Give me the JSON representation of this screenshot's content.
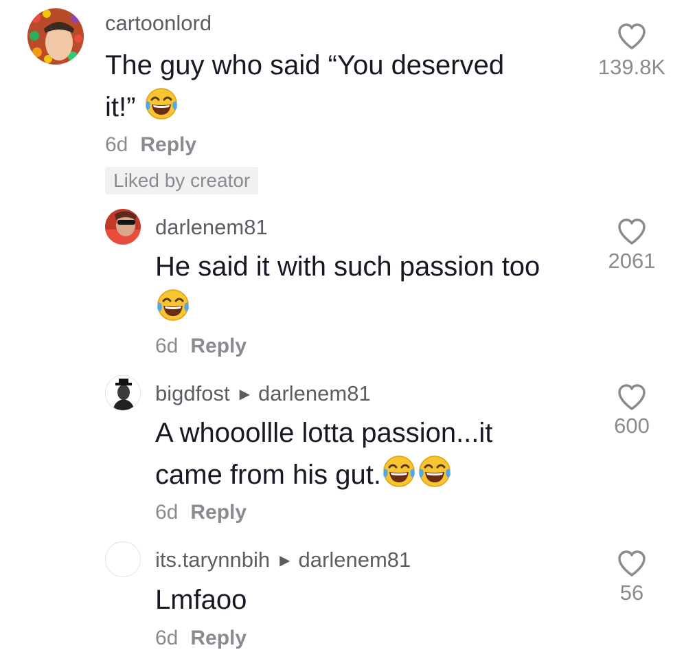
{
  "comments": [
    {
      "username": "cartoonlord",
      "reply_to": "",
      "text": "The guy who said “You deserved",
      "text_line2": "it!”",
      "emoji": [
        "face-with-tears-of-joy"
      ],
      "time": "6d",
      "reply_label": "Reply",
      "likes": "139.8K",
      "badge": "Liked by creator"
    },
    {
      "username": "darlenem81",
      "reply_to": "",
      "text": "He said it with such passion too",
      "emoji": [
        "face-with-tears-of-joy"
      ],
      "time": "6d",
      "reply_label": "Reply",
      "likes": "2061"
    },
    {
      "username": "bigdfost",
      "reply_to": "darlenem81",
      "text": "A whooollle lotta passion...it",
      "text_line2": "came from his gut.",
      "emoji": [
        "face-with-tears-of-joy",
        "face-with-tears-of-joy"
      ],
      "time": "6d",
      "reply_label": "Reply",
      "likes": "600"
    },
    {
      "username": "its.tarynnbih",
      "reply_to": "darlenem81",
      "text": "Lmfaoo",
      "emoji": [],
      "time": "6d",
      "reply_label": "Reply",
      "likes": "56"
    }
  ],
  "colors": {
    "text": "#161823",
    "secondary": "#8a8b91",
    "username": "#5c5d64",
    "badge_bg": "#f1f1f2"
  }
}
